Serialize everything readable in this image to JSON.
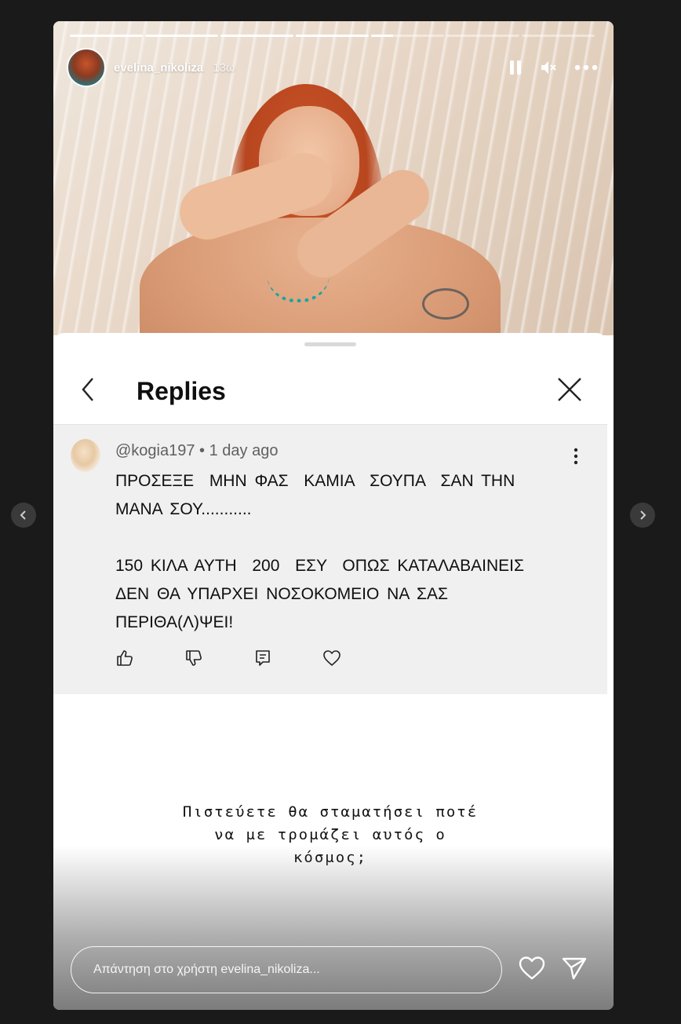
{
  "story": {
    "username": "evelina_nikoliza",
    "time": "13ω",
    "progress_segments": [
      1,
      1,
      1,
      1,
      0.3,
      0,
      0
    ]
  },
  "header_icons": [
    "pause-icon",
    "mute-icon",
    "more-icon"
  ],
  "replies": {
    "title": "Replies",
    "comment": {
      "handle": "@kogia197",
      "separator": "•",
      "time_ago": "1 day ago",
      "text": "ΠΡΟΣΕΞΕ  ΜΗΝ ΦΑΣ  ΚΑΜΙΑ  ΣΟΥΠΑ  ΣΑΝ ΤΗΝ\nΜΑΝΑ ΣΟΥ...........\n\n150 ΚΙΛΑ ΑΥΤΗ  200  ΕΣΥ  ΟΠΩΣ ΚΑΤΑΛΑΒΑΙΝΕΙΣ\nΔΕΝ ΘΑ ΥΠΑΡΧΕΙ ΝΟΣΟΚΟΜΕΙΟ ΝΑ ΣΑΣ\nΠΕΡΙΘΑ(Λ)ΨΕΙ!"
    }
  },
  "caption": "Πιστεύετε θα σταματήσει ποτέ\nνα με τρομάζει αυτός ο\nκόσμος;",
  "reply_input": {
    "placeholder": "Απάντηση στο χρήστη evelina_nikoliza..."
  }
}
